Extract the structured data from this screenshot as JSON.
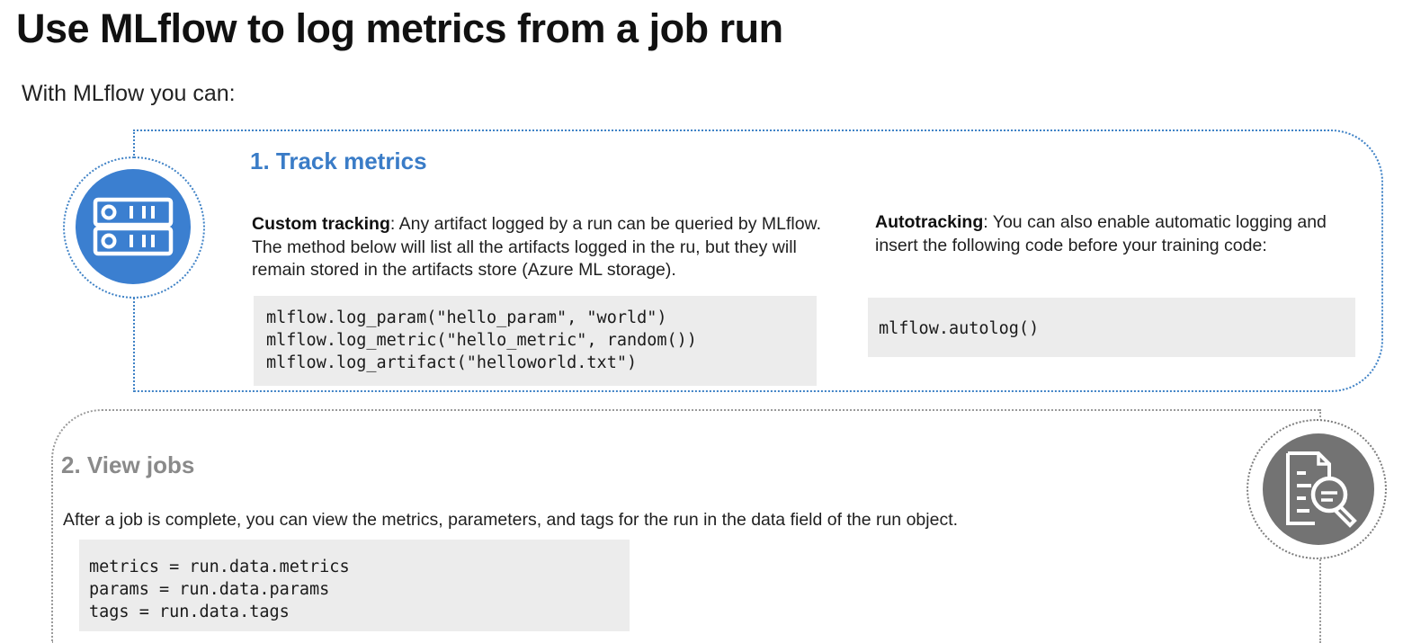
{
  "title": "Use MLflow to log metrics from a job run",
  "intro": "With MLflow you can:",
  "section1": {
    "heading": "1. Track metrics",
    "icon": "server-rack-icon",
    "custom": {
      "label": "Custom tracking",
      "text": ": Any artifact logged by a run can be queried by MLflow. The method below will list all the artifacts logged in the ru, but they will remain stored in the artifacts store (Azure ML storage)."
    },
    "code": [
      "mlflow.log_param(\"hello_param\", \"world\")",
      "mlflow.log_metric(\"hello_metric\", random())",
      "mlflow.log_artifact(\"helloworld.txt\")"
    ],
    "auto": {
      "label": "Autotracking",
      "text": ": You can also enable automatic logging and insert the following code before your training code:"
    },
    "auto_code": "mlflow.autolog()"
  },
  "section2": {
    "heading": "2. View jobs",
    "icon": "document-search-icon",
    "text": "After a job is complete, you can view the metrics, parameters, and tags for the run in the data field of the run object.",
    "code": [
      "metrics = run.data.metrics",
      "params = run.data.params",
      "tags = run.data.tags"
    ]
  },
  "colors": {
    "accent_blue": "#3a7cc7",
    "icon_blue": "#3b7fd0",
    "muted_gray": "#8a8a8a",
    "icon_gray": "#737373",
    "code_bg": "#ececec"
  }
}
